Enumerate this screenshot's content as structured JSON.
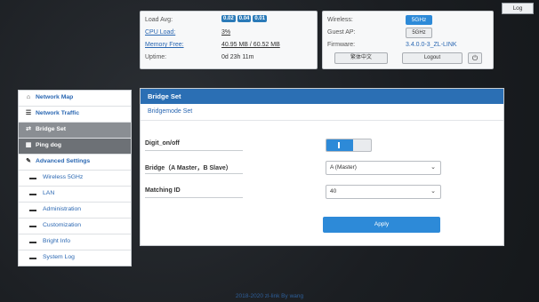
{
  "log_button": "Log",
  "stats": {
    "load_avg_label": "Load Avg:",
    "load_avg_values": [
      "0.02",
      "0.04",
      "0.01"
    ],
    "cpu_label": "CPU Load:",
    "cpu_value": "3%",
    "mem_label": "Memory Free:",
    "mem_value": "40.95 MB / 60.52 MB",
    "uptime_label": "Uptime:",
    "uptime_value": "0d 23h 11m"
  },
  "device": {
    "wireless_label": "Wireless:",
    "wireless_value": "5GHz",
    "guest_label": "Guest AP:",
    "guest_value": "5GHz",
    "firmware_label": "Firmware:",
    "firmware_value": "3.4.0.0-3_ZL-LINK",
    "lang_button": "繁体中文",
    "logout_button": "Logout"
  },
  "sidebar": {
    "items": [
      {
        "label": "Network Map"
      },
      {
        "label": "Network Traffic"
      },
      {
        "label": "Bridge Set"
      },
      {
        "label": "Ping dog"
      },
      {
        "label": "Advanced Settings"
      },
      {
        "label": "Wireless 5GHz"
      },
      {
        "label": "LAN"
      },
      {
        "label": "Administration"
      },
      {
        "label": "Customization"
      },
      {
        "label": "Bright Info"
      },
      {
        "label": "System Log"
      }
    ]
  },
  "main": {
    "title": "Bridge Set",
    "subtitle": "Bridgemode Set",
    "digit_label": "Digit_on/off",
    "bridge_label": "Bridge（A Master，B Slave）",
    "bridge_value": "A (Master)",
    "matching_label": "Matching ID",
    "matching_value": "40",
    "apply_label": "Apply"
  },
  "footer": "2018-2020 zl-link By wang",
  "colors": {
    "accent": "#2b6fb4",
    "button": "#2d8ad8",
    "badge": "#2a7ab8"
  }
}
